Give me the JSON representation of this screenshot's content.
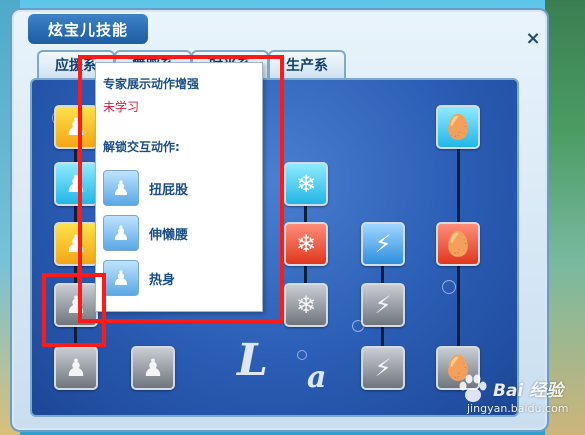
{
  "window": {
    "title": "炫宝儿技能",
    "close_label": "×"
  },
  "tabs": [
    "应援系",
    "舞蹈系",
    "时尚系",
    "生产系"
  ],
  "tooltip": {
    "title": "专家展示动作增强",
    "status": "未学习",
    "subheading": "解锁交互动作:",
    "actions": [
      {
        "icon": "twist-pose-icon",
        "label": "扭屁股"
      },
      {
        "icon": "stretch-pose-icon",
        "label": "伸懒腰"
      },
      {
        "icon": "warmup-pose-icon",
        "label": "热身"
      }
    ],
    "status_color": "#e0193a"
  },
  "skill_icons": {
    "col1": [
      "idol-yellow-icon",
      "idol-cyan-icon",
      "idol-yellow-icon",
      "idol-grey-icon",
      "idol-grey-icon"
    ],
    "col2": [
      "gesture-yellow-icon",
      "group-grey-icon"
    ],
    "col3": [
      "flame-faded-icon",
      "flame-faded-icon",
      "flame-faded-icon"
    ],
    "col4": [
      "snowflake-cyan-icon",
      "snowflake-red-icon",
      "snowflake-grey-icon"
    ],
    "col5": [
      "lightning-blue-icon",
      "lightning-grey-icon",
      "lightning-grey-icon"
    ],
    "col6": [
      "egg-cyan-icon",
      "egg-red-icon",
      "egg-grey-icon"
    ]
  },
  "decorations": {
    "letters": [
      "L",
      "a"
    ]
  },
  "watermark": {
    "main": "Bai 经验",
    "url": "jingyan.baidu.com"
  }
}
